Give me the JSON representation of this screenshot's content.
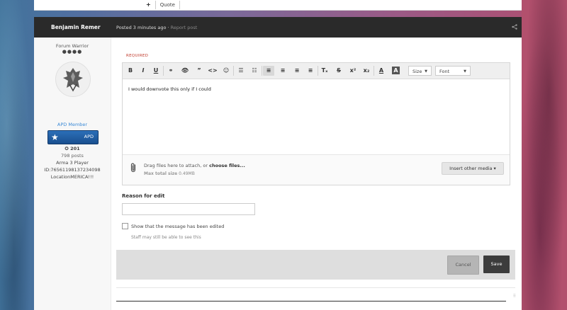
{
  "top_bar": {
    "plus": "+",
    "quote_label": "Quote"
  },
  "post": {
    "author": "Benjamin Remer",
    "posted": "Posted 3 minutes ago",
    "separator": " · ",
    "report": "Report post",
    "share_icon": "share-icon"
  },
  "author_info": {
    "rank": "Forum Warrior",
    "rank_dots": "●●●●",
    "group": "APD Member",
    "badge_label": "APD",
    "reputation": "✪ 201",
    "posts": "798 posts",
    "game": "Arma 3 Player",
    "id": "ID:76561198137234098",
    "location": "LocationMERICA!!!"
  },
  "editor": {
    "required_label": "REQUIRED",
    "toolbar": {
      "bold": "B",
      "italic": "I",
      "underline": "U",
      "link": "⚭",
      "spoiler": "👁",
      "quote": "”",
      "code": "<>",
      "emoji": "☺",
      "bullet_list": "☰",
      "numbered_list": "☷",
      "align_left": "≡",
      "align_center": "≡",
      "align_right": "≡",
      "justify": "≡",
      "clear_format": "Tₓ",
      "strike": "S",
      "superscript": "x²",
      "subscript": "x₂",
      "font_color": "A",
      "bg_color": "A",
      "size_label": "Size",
      "font_label": "Font",
      "caret": "▼"
    },
    "content": "I would downvote this only if I could",
    "attach_text": "Drag files here to attach, or ",
    "attach_link": "choose files...",
    "max_size_label": "Max total size",
    "max_size_value": "0.49MB",
    "insert_media": "Insert other media ▾"
  },
  "edit_reason": {
    "label": "Reason for edit",
    "value": "",
    "checkbox_label": "Show that the message has been edited",
    "hint": "Staff may still be able to see this"
  },
  "actions": {
    "cancel": "Cancel",
    "save": "Save"
  },
  "colors": {
    "header_bg": "#2a2a2a",
    "link_blue": "#3b8ad6",
    "required_red": "#c0392b",
    "save_bg": "#3c3c3c"
  }
}
